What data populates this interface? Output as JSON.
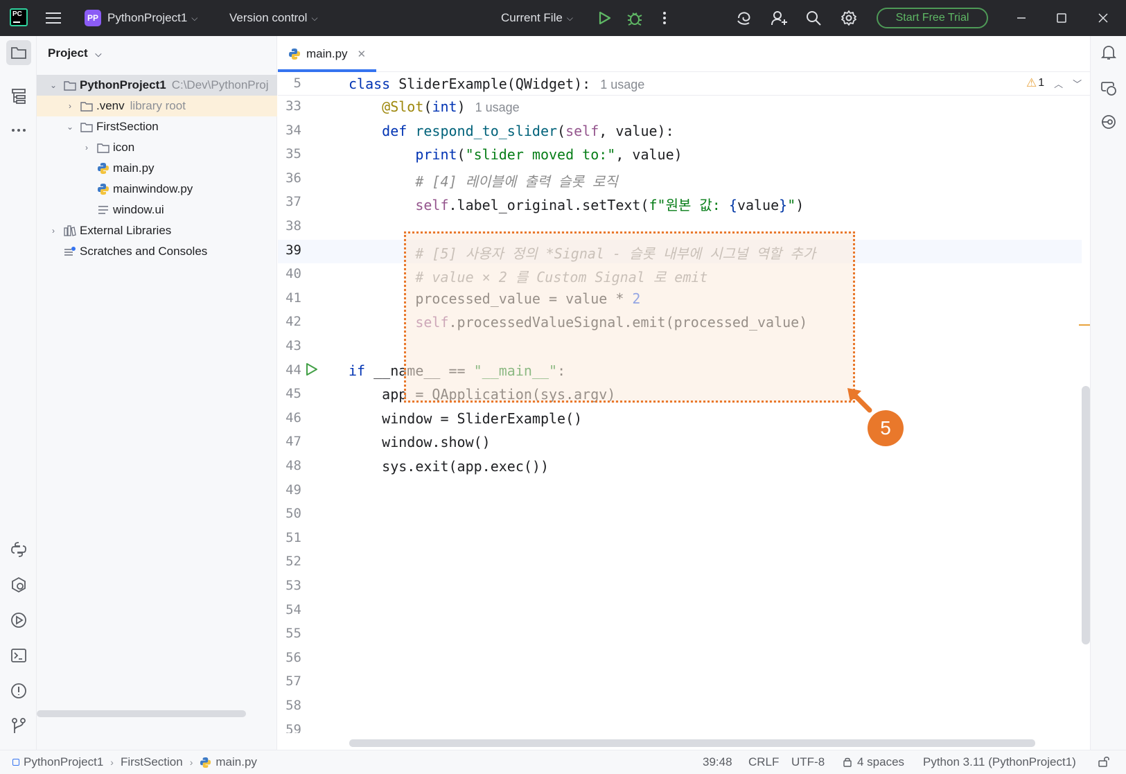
{
  "titlebar": {
    "logo_text": "PC",
    "project_badge": "PP",
    "project_name": "PythonProject1",
    "version_control": "Version control",
    "run_config": "Current File",
    "trial_button": "Start Free Trial"
  },
  "project_panel": {
    "title": "Project",
    "tree": [
      {
        "label": "PythonProject1",
        "hint": "C:\\Dev\\PythonProj",
        "expanded": true,
        "icon": "folder-icon"
      },
      {
        "label": ".venv",
        "hint": "library root",
        "expanded": false,
        "icon": "folder-icon"
      },
      {
        "label": "FirstSection",
        "hint": "",
        "expanded": true,
        "icon": "folder-icon"
      },
      {
        "label": "icon",
        "hint": "",
        "expanded": false,
        "icon": "folder-icon"
      },
      {
        "label": "main.py",
        "hint": "",
        "icon": "python-file-icon"
      },
      {
        "label": "mainwindow.py",
        "hint": "",
        "icon": "python-file-icon"
      },
      {
        "label": "window.ui",
        "hint": "",
        "icon": "ui-file-icon"
      },
      {
        "label": "External Libraries",
        "hint": "",
        "expanded": false,
        "icon": "library-icon"
      },
      {
        "label": "Scratches and Consoles",
        "hint": "",
        "icon": "scratches-icon"
      }
    ]
  },
  "editor": {
    "tab_label": "main.py",
    "sticky_line": {
      "number": "5",
      "usage": "1 usage"
    },
    "warnings": "1",
    "line_numbers": [
      "33",
      "34",
      "35",
      "36",
      "37",
      "38",
      "39",
      "40",
      "41",
      "42",
      "43",
      "44",
      "45",
      "46",
      "47",
      "48",
      "49",
      "50",
      "51",
      "52",
      "53",
      "54",
      "55",
      "56",
      "57",
      "58",
      "59"
    ],
    "decorator_usage": "1 usage",
    "callout_number": "5"
  },
  "statusbar": {
    "breadcrumb": [
      "PythonProject1",
      "FirstSection",
      "main.py"
    ],
    "position": "39:48",
    "line_ending": "CRLF",
    "encoding": "UTF-8",
    "indent": "4 spaces",
    "interpreter": "Python 3.11 (PythonProject1)"
  },
  "colors": {
    "accent": "#3574f0",
    "highlight_border": "#e9782b",
    "run_green": "#5fb865"
  }
}
